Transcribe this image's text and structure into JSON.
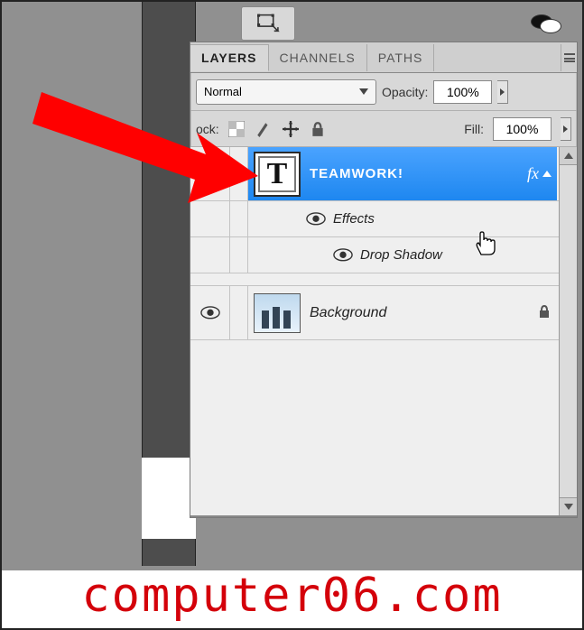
{
  "toolbar": {
    "transform_icon": "free-transform-icon"
  },
  "panel": {
    "tabs": {
      "layers": "LAYERS",
      "channels": "CHANNELS",
      "paths": "PATHS"
    },
    "blend_mode": "Normal",
    "opacity_label": "Opacity:",
    "opacity_value": "100%",
    "lock_label": "ock:",
    "fill_label": "Fill:",
    "fill_value": "100%"
  },
  "layers": {
    "text_layer": {
      "name": "TEAMWORK!",
      "fx": "fx",
      "thumb_glyph": "T"
    },
    "effects_label": "Effects",
    "drop_shadow_label": "Drop Shadow",
    "background": {
      "name": "Background"
    }
  },
  "watermark": "computer06.com"
}
